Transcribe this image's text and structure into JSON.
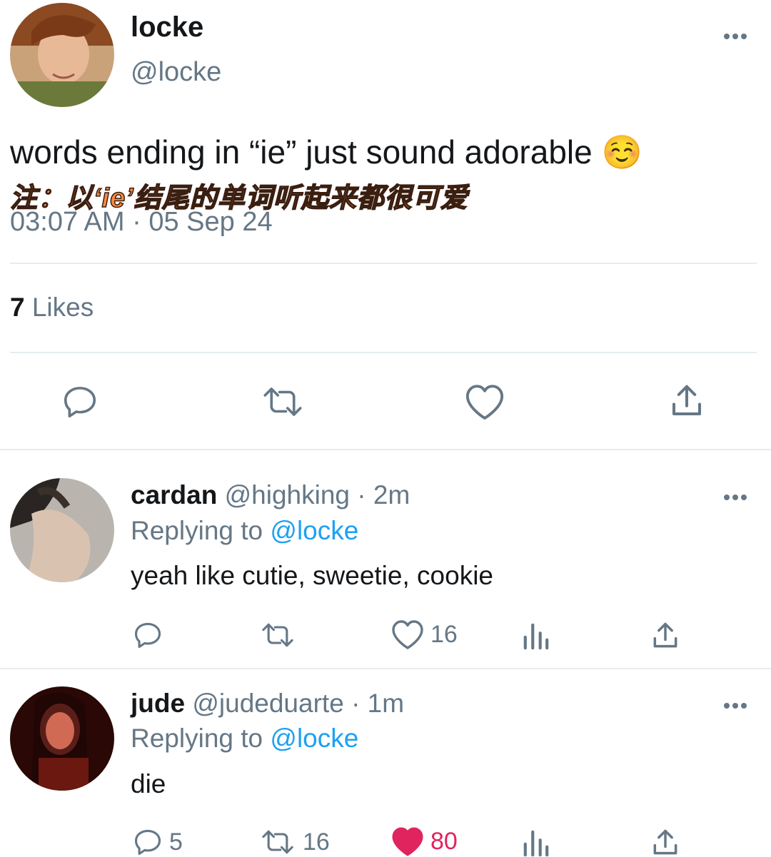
{
  "main_tweet": {
    "display_name": "locke",
    "handle": "@locke",
    "text": "words ending in “ie” just sound adorable ☺️",
    "note": "注：以‘ie’结尾的单词听起来都很可爱",
    "timestamp": "03:07 AM · 05 Sep 24",
    "likes_count": "7",
    "likes_label": "Likes"
  },
  "replies": [
    {
      "display_name": "cardan",
      "handle": "@highking",
      "time": "· 2m",
      "replying_prefix": "Replying to",
      "replying_to": "@locke",
      "text": "yeah like cutie, sweetie, cookie",
      "reply_count": "",
      "retweet_count": "",
      "like_count": "16",
      "liked": false
    },
    {
      "display_name": "jude",
      "handle": "@judeduarte",
      "time": "· 1m",
      "replying_prefix": "Replying to",
      "replying_to": "@locke",
      "text": "die",
      "reply_count": "5",
      "retweet_count": "16",
      "like_count": "80",
      "liked": true
    }
  ],
  "colors": {
    "text": "#14171a",
    "muted": "#657786",
    "link": "#1da1f2",
    "liked": "#e0245e",
    "note_fill": "#ff8a3d",
    "divider": "#e6ecf0"
  },
  "icons": {
    "reply": "reply-icon",
    "retweet": "retweet-icon",
    "like": "heart-icon",
    "analytics": "analytics-icon",
    "share": "share-icon",
    "more": "more-icon"
  }
}
